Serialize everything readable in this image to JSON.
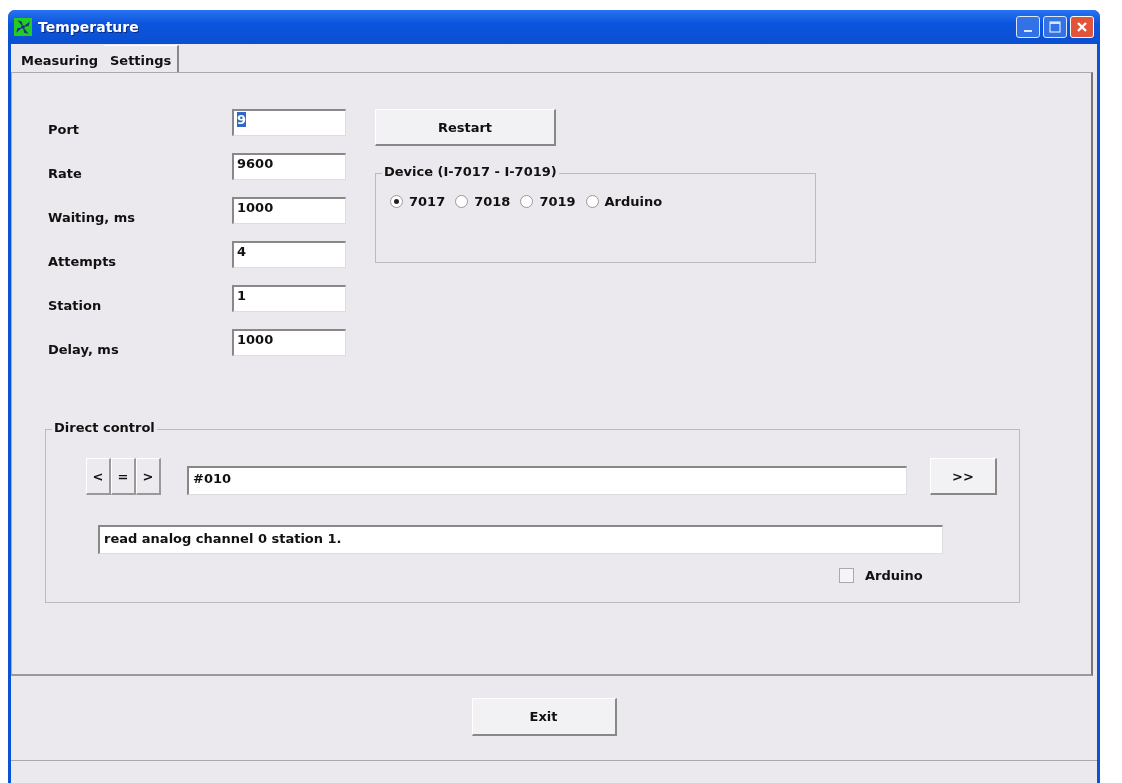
{
  "window": {
    "title": "Temperature"
  },
  "tabs": [
    {
      "label": "Measuring",
      "selected": false
    },
    {
      "label": "Settings",
      "selected": true
    }
  ],
  "settings": [
    {
      "label": "Port",
      "value": "9",
      "text_selected": true
    },
    {
      "label": "Rate",
      "value": "9600",
      "text_selected": false
    },
    {
      "label": "Waiting, ms",
      "value": "1000",
      "text_selected": false
    },
    {
      "label": "Attempts",
      "value": "4",
      "text_selected": false
    },
    {
      "label": "Station",
      "value": "1",
      "text_selected": false
    },
    {
      "label": "Delay, ms",
      "value": "1000",
      "text_selected": false
    }
  ],
  "restart_button": "Restart",
  "device": {
    "title": "Device (I-7017 - I-7019)",
    "options": [
      {
        "label": "7017",
        "selected": true
      },
      {
        "label": "7018",
        "selected": false
      },
      {
        "label": "7019",
        "selected": false
      },
      {
        "label": "Arduino",
        "selected": false
      }
    ]
  },
  "direct_control": {
    "title": "Direct control",
    "nav_buttons": [
      "<",
      "=",
      ">"
    ],
    "command": "#010",
    "send_button": ">>",
    "description": "read analog channel 0 station 1.",
    "arduino": {
      "label": "Arduino",
      "checked": false
    }
  },
  "exit_button": "Exit"
}
